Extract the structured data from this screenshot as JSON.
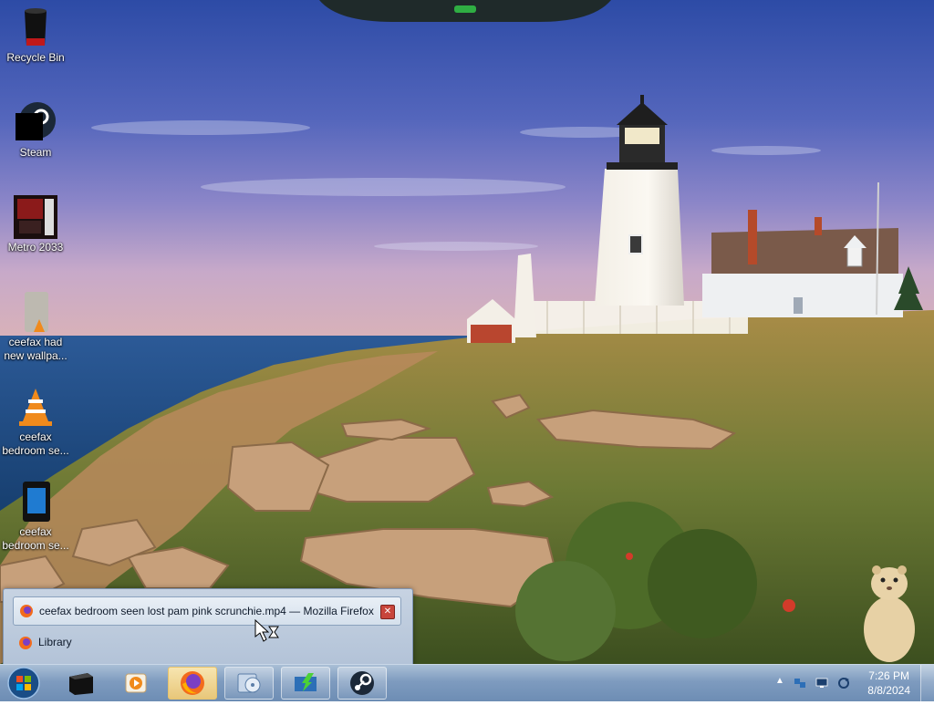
{
  "desktop": {
    "icons": [
      {
        "label": "Recycle Bin"
      },
      {
        "label": "Steam"
      },
      {
        "label": "Metro 2033"
      },
      {
        "label_line1": "ceefax had",
        "label_line2": "new wallpa..."
      },
      {
        "label_line1": "ceefax",
        "label_line2": "bedroom se..."
      },
      {
        "label_line1": "ceefax",
        "label_line2": "bedroom se..."
      }
    ]
  },
  "jumplist": {
    "active_window": "ceefax bedroom seen lost pam pink scrunchie.mp4 — Mozilla Firefox",
    "close_symbol": "✕",
    "library_label": "Library"
  },
  "taskbar": {
    "start_icon": "windows-orb-icon",
    "pinned": [
      "terminal-icon",
      "media-player-icon",
      "firefox-icon",
      "disk-utility-icon",
      "download-manager-icon",
      "steam-icon"
    ],
    "active_index": 2
  },
  "tray": {
    "time": "7:26 PM",
    "date": "8/8/2024"
  },
  "colors": {
    "sky_top": "#2f4fa8",
    "sky_mid": "#6f79c4",
    "ocean": "#1f4f8a",
    "taskbar": "#7e9bbf"
  }
}
